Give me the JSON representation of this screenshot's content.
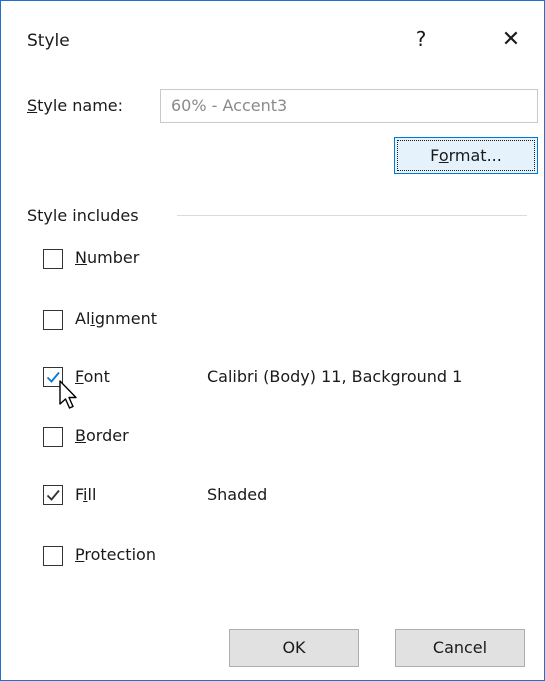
{
  "dialog": {
    "title": "Style",
    "help_glyph": "?",
    "close_glyph": "✕"
  },
  "style_name": {
    "label_accel": "S",
    "label_rest": "tyle name:",
    "value": "60% - Accent3"
  },
  "format_button": {
    "pre": "F",
    "accel": "o",
    "post": "rmat..."
  },
  "style_includes": {
    "title": "Style includes",
    "items": [
      {
        "pre": "",
        "accel": "N",
        "post": "umber",
        "checked": false,
        "value": ""
      },
      {
        "pre": "Al",
        "accel": "i",
        "post": "gnment",
        "checked": false,
        "value": ""
      },
      {
        "pre": "",
        "accel": "F",
        "post": "ont",
        "checked": true,
        "value": "Calibri (Body) 11, Background 1"
      },
      {
        "pre": "",
        "accel": "B",
        "post": "order",
        "checked": false,
        "value": ""
      },
      {
        "pre": "F",
        "accel": "i",
        "post": "ll",
        "checked": true,
        "value": "Shaded"
      },
      {
        "pre": "",
        "accel": "P",
        "post": "rotection",
        "checked": false,
        "value": ""
      }
    ]
  },
  "buttons": {
    "ok": "OK",
    "cancel": "Cancel"
  },
  "colors": {
    "accent": "#1e73c9",
    "checkmark": "#0078d7"
  }
}
